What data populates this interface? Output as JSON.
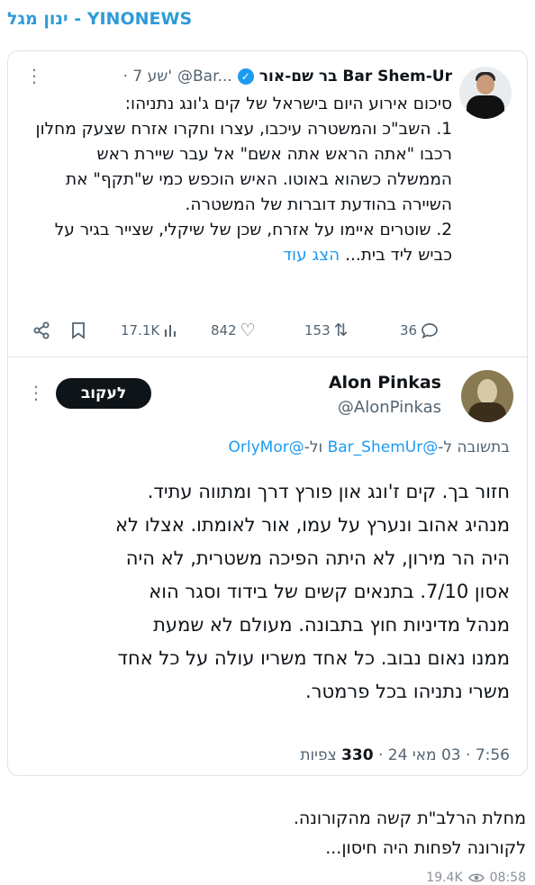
{
  "channel": {
    "name": "YINONEWS - ינון מגל"
  },
  "quoted_tweet": {
    "author_name": "בר שם-אור Bar Shem-Ur",
    "handle": "@Bar...",
    "time": "· 7 שע'",
    "more_icon": "more-icon",
    "lines": [
      "סיכום אירוע היום בישראל של קים ג'ונג נתניהו:",
      "1. השב\"כ והמשטרה עיכבו, עצרו וחקרו אזרח שצעק מחלון רכבו \"אתה הראש אתה אשם\" אל עבר שיירת ראש הממשלה כשהוא באוטו. האיש הוכפש כמי ש\"תקף\" את השיירה בהודעת דוברות של המשטרה.",
      "2. שוטרים איימו על אזרח, שכן של שיקלי, שצייר בגיר על כביש ליד בית..."
    ],
    "show_more": "הצג עוד",
    "stats": {
      "replies": "36",
      "retweets": "153",
      "likes": "842",
      "views": "17.1K"
    }
  },
  "tweet": {
    "author_name": "Alon Pinkas",
    "handle": "@AlonPinkas",
    "follow_label": "לעקוב",
    "reply_prefix": "בתשובה ל-",
    "reply_mention_1": "@Bar_ShemUr",
    "reply_conjunction": " ול-",
    "reply_mention_2": "@OrlyMor",
    "text_lines": [
      "חזור בך. קים ז'ונג און פורץ דרך ומתווה עתיד.",
      "מנהיג אהוב ונערץ על עמו, אור לאומתו. אצלו לא",
      "היה הר מירון, לא היתה הפיכה משטרית, לא היה",
      "אסון 7/10. בתנאים קשים של בידוד וסגר הוא",
      "מנהל מדיניות חוץ בתבונה. מעולם לא שמעת",
      "ממנו נאום נבוב. כל אחד משריו עולה על כל אחד",
      "משרי נתניהו בכל פרמטר."
    ],
    "time": "7:56",
    "date": "03 מאי 24",
    "views_count": "330",
    "views_label": "צפיות"
  },
  "post": {
    "lines": [
      "מחלת הרלב\"ת קשה מהקורונה.",
      "לקורונה לפחות היה חיסון..."
    ],
    "views": "19.4K",
    "time": "08:58"
  }
}
